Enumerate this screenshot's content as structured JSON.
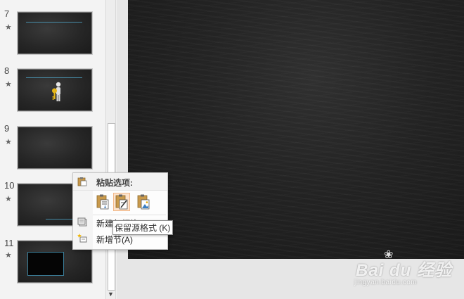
{
  "thumbnails": [
    {
      "number": "7",
      "marker": "★"
    },
    {
      "number": "8",
      "marker": "★"
    },
    {
      "number": "9",
      "marker": "★"
    },
    {
      "number": "10",
      "marker": "★"
    },
    {
      "number": "11",
      "marker": "★"
    }
  ],
  "context_menu": {
    "paste_options_label": "粘贴选项:",
    "paste_buttons": [
      {
        "icon": "paste-use-destination-theme-icon"
      },
      {
        "icon": "paste-keep-source-formatting-icon",
        "active": true
      },
      {
        "icon": "paste-as-picture-icon"
      }
    ],
    "items": [
      {
        "label": "新建幻灯片(N)",
        "icon": "new-slide-icon"
      },
      {
        "label": "新增节(A)",
        "icon": "new-section-icon"
      }
    ]
  },
  "tooltip": {
    "text": "保留源格式 (K)"
  },
  "watermark": {
    "brand": "Bai du 经验",
    "sub": "jingyan.baidu.com"
  },
  "colors": {
    "accent_line": "#4fa6c9",
    "active_paste_bg": "#fde3cc"
  }
}
